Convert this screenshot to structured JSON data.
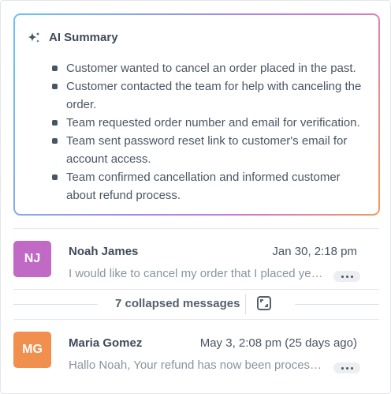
{
  "ai_summary": {
    "title": "AI Summary",
    "icon": "sparkles-icon",
    "points": [
      "Customer wanted to cancel an order placed in the past.",
      "Customer contacted the team for help with canceling the order.",
      "Team requested order number and email for verification.",
      "Team sent password reset link to customer's email for account access.",
      "Team confirmed cancellation and informed customer about refund process."
    ]
  },
  "messages": [
    {
      "initials": "NJ",
      "avatar_color": "#c06ac5",
      "name": "Noah James",
      "date": "Jan 30, 2:18 pm",
      "preview": "I would like to cancel my order that I placed yesterday. Could you please help me"
    },
    {
      "initials": "MG",
      "avatar_color": "#f08f4e",
      "name": "Maria Gomez",
      "date": "May 3, 2:08 pm (25 days ago)",
      "preview": "Hallo Noah, Your refund has now been processed and you should see it soon"
    }
  ],
  "collapsed": {
    "label": "7 collapsed messages",
    "icon": "expand-icon"
  },
  "colors": {
    "gradient": [
      "#6cc3ef",
      "#9e8df0",
      "#cf79d6",
      "#f29a5b"
    ],
    "text": "#4a5564"
  }
}
